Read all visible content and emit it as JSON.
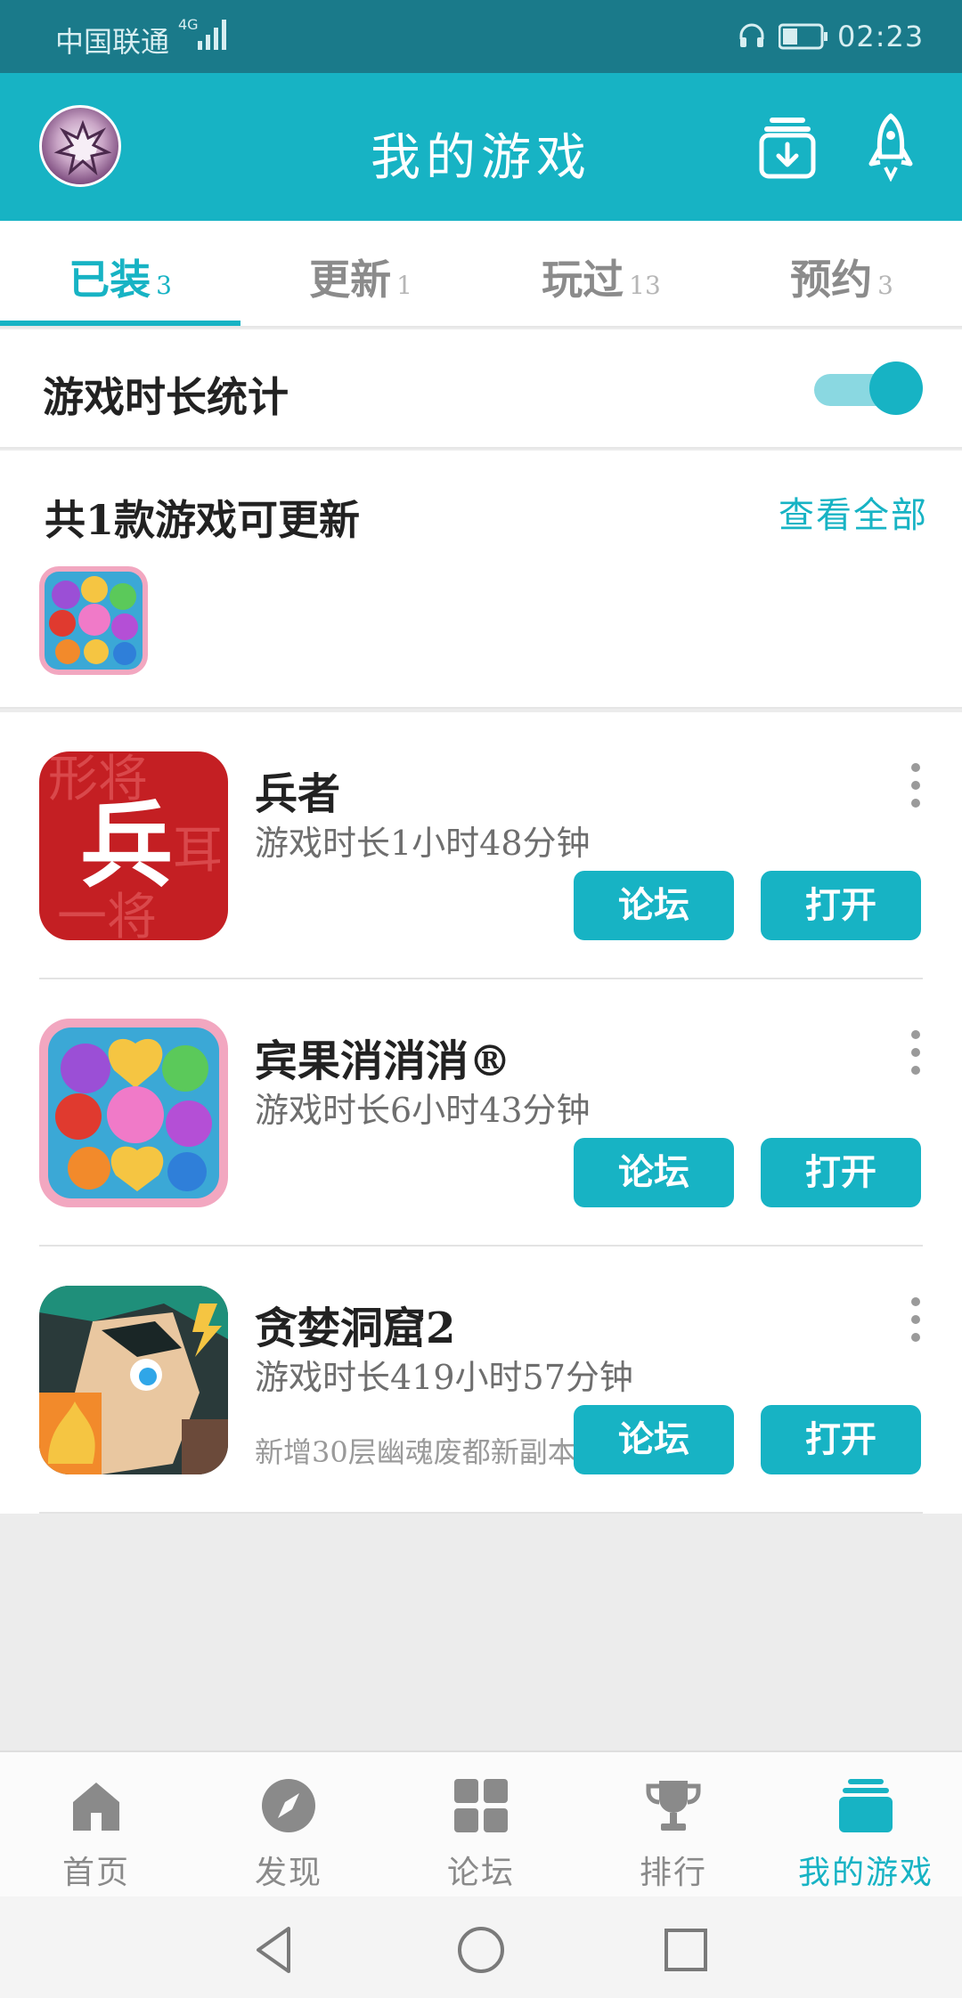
{
  "status_bar": {
    "carrier": "中国联通",
    "network": "4G",
    "time": "02:23"
  },
  "header": {
    "title": "我的游戏",
    "download_icon": "download-box-icon",
    "rocket_icon": "rocket-icon"
  },
  "tabs": [
    {
      "label": "已装",
      "count": "3",
      "active": true
    },
    {
      "label": "更新",
      "count": "1",
      "active": false
    },
    {
      "label": "玩过",
      "count": "13",
      "active": false
    },
    {
      "label": "预约",
      "count": "3",
      "active": false
    }
  ],
  "stats_toggle": {
    "label": "游戏时长统计",
    "on": true
  },
  "update_section": {
    "label": "共1款游戏可更新",
    "view_all": "查看全部"
  },
  "games": [
    {
      "name": "兵者",
      "playtime": "游戏时长1小时48分钟",
      "news": "",
      "icon_glyph": "兵",
      "forum_label": "论坛",
      "open_label": "打开"
    },
    {
      "name": "宾果消消消®",
      "playtime": "游戏时长6小时43分钟",
      "news": "",
      "forum_label": "论坛",
      "open_label": "打开"
    },
    {
      "name": "贪婪洞窟2",
      "playtime": "游戏时长419小时57分钟",
      "news": "新增30层幽魂废都新副本",
      "forum_label": "论坛",
      "open_label": "打开"
    }
  ],
  "bottom_nav": [
    {
      "label": "首页",
      "icon": "home-icon",
      "active": false
    },
    {
      "label": "发现",
      "icon": "compass-icon",
      "active": false
    },
    {
      "label": "论坛",
      "icon": "grid-icon",
      "active": false
    },
    {
      "label": "排行",
      "icon": "trophy-icon",
      "active": false
    },
    {
      "label": "我的游戏",
      "icon": "game-box-icon",
      "active": true
    }
  ],
  "colors": {
    "accent": "#17b3c4",
    "status_bar": "#1a7a8a"
  }
}
